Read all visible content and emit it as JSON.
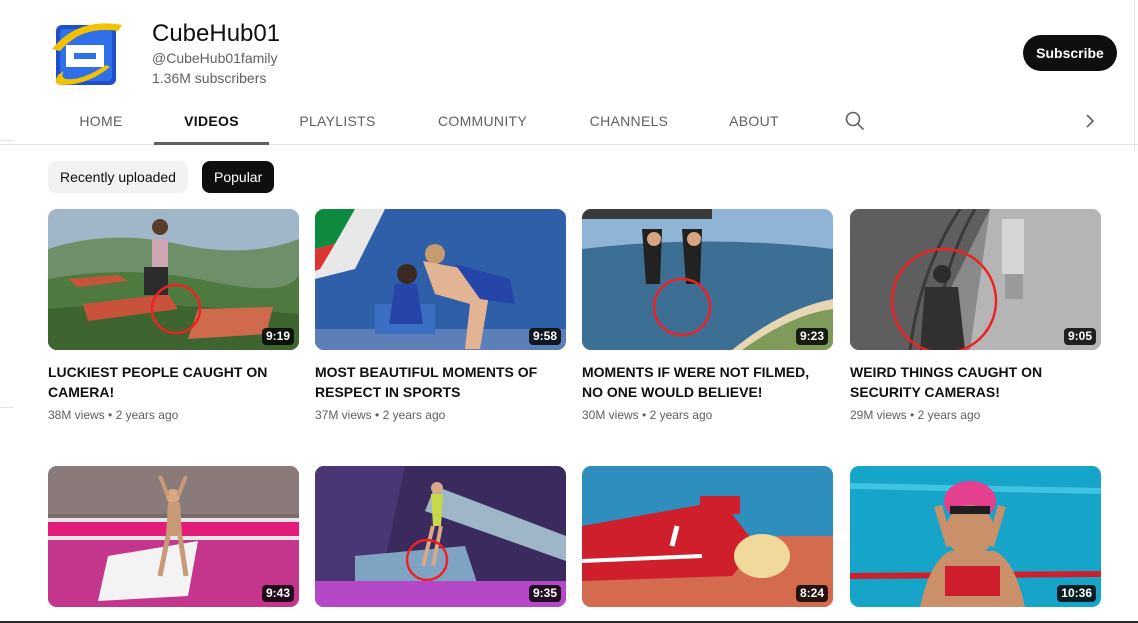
{
  "channel": {
    "name": "CubeHub01",
    "handle": "@CubeHub01family",
    "subscribers": "1.36M subscribers",
    "subscribe_label": "Subscribe"
  },
  "tabs": [
    {
      "label": "HOME"
    },
    {
      "label": "VIDEOS"
    },
    {
      "label": "PLAYLISTS"
    },
    {
      "label": "COMMUNITY"
    },
    {
      "label": "CHANNELS"
    },
    {
      "label": "ABOUT"
    }
  ],
  "active_tab": "VIDEOS",
  "filters": [
    {
      "label": "Recently uploaded"
    },
    {
      "label": "Popular"
    }
  ],
  "selected_filter": "Popular",
  "videos": [
    {
      "title": "LUCKIEST PEOPLE CAUGHT ON CAMERA!",
      "views": "38M views",
      "age": "2 years ago",
      "duration": "9:19"
    },
    {
      "title": "MOST BEAUTIFUL MOMENTS OF RESPECT IN SPORTS",
      "views": "37M views",
      "age": "2 years ago",
      "duration": "9:58"
    },
    {
      "title": "MOMENTS IF WERE NOT FILMED, NO ONE WOULD BELIEVE!",
      "views": "30M views",
      "age": "2 years ago",
      "duration": "9:23"
    },
    {
      "title": "WEIRD THINGS CAUGHT ON SECURITY CAMERAS!",
      "views": "29M views",
      "age": "2 years ago",
      "duration": "9:05"
    },
    {
      "duration": "9:43"
    },
    {
      "duration": "9:35"
    },
    {
      "duration": "8:24"
    },
    {
      "duration": "10:36"
    }
  ],
  "meta_separator": "•",
  "colors": {
    "subscribe_bg": "#0f0f0f",
    "secondary_text": "#606060",
    "chip_light": "#f2f2f2"
  },
  "icons": [
    "channel-avatar-e-icon",
    "search-icon",
    "chevron-right-icon"
  ]
}
